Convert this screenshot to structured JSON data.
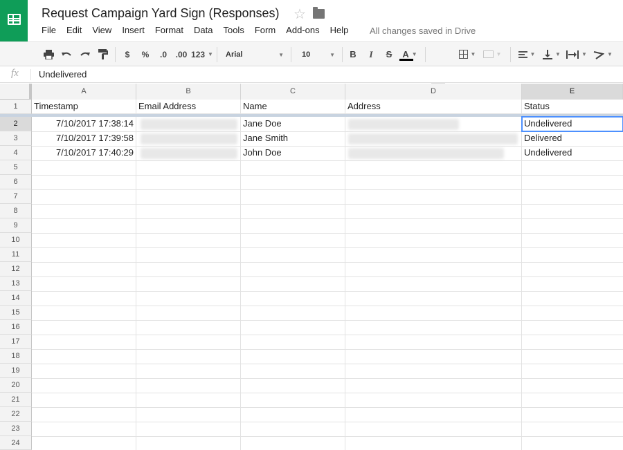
{
  "app": {
    "title": "Request Campaign Yard Sign (Responses)",
    "save_status": "All changes saved in Drive",
    "brand_color": "#0f9d58"
  },
  "menu": [
    "File",
    "Edit",
    "View",
    "Insert",
    "Format",
    "Data",
    "Tools",
    "Form",
    "Add-ons",
    "Help"
  ],
  "toolbar": {
    "currency": "$",
    "percent": "%",
    "decrease_decimals": ".0",
    "increase_decimals": ".00",
    "more_formats": "123",
    "font": "Arial",
    "font_size": "10",
    "bold": "B",
    "italic": "I",
    "strikethrough": "S",
    "text_color_label": "A",
    "icons": [
      "print-icon",
      "undo-icon",
      "redo-icon",
      "paint-format-icon",
      "fill-color-icon",
      "borders-icon",
      "merge-cells-icon",
      "horizontal-align-icon",
      "vertical-align-icon",
      "text-wrap-icon",
      "text-rotation-icon"
    ]
  },
  "formula_bar": {
    "fx": "fx",
    "value": "Undelivered"
  },
  "sheet": {
    "column_letters": [
      "A",
      "B",
      "C",
      "D",
      "E"
    ],
    "selected_column": "E",
    "selected_row": 2,
    "row_numbers": [
      "1",
      "2",
      "3",
      "4",
      "5",
      "6",
      "7",
      "8",
      "9",
      "10",
      "11",
      "12",
      "13",
      "14",
      "15",
      "16",
      "17",
      "18",
      "19",
      "20",
      "21",
      "22",
      "23",
      "24"
    ],
    "headers": [
      "Timestamp",
      "Email Address",
      "Name",
      "Address",
      "Status"
    ],
    "rows": [
      {
        "timestamp": "7/10/2017 17:38:14",
        "email": "",
        "name": "Jane Doe",
        "address": "",
        "status": "Undelivered"
      },
      {
        "timestamp": "7/10/2017 17:39:58",
        "email": "",
        "name": "Jane Smith",
        "address": "",
        "status": "Delivered"
      },
      {
        "timestamp": "7/10/2017 17:40:29",
        "email": "",
        "name": "John Doe",
        "address": "",
        "status": "Undelivered"
      }
    ],
    "selection_color": "#4d90fe"
  }
}
